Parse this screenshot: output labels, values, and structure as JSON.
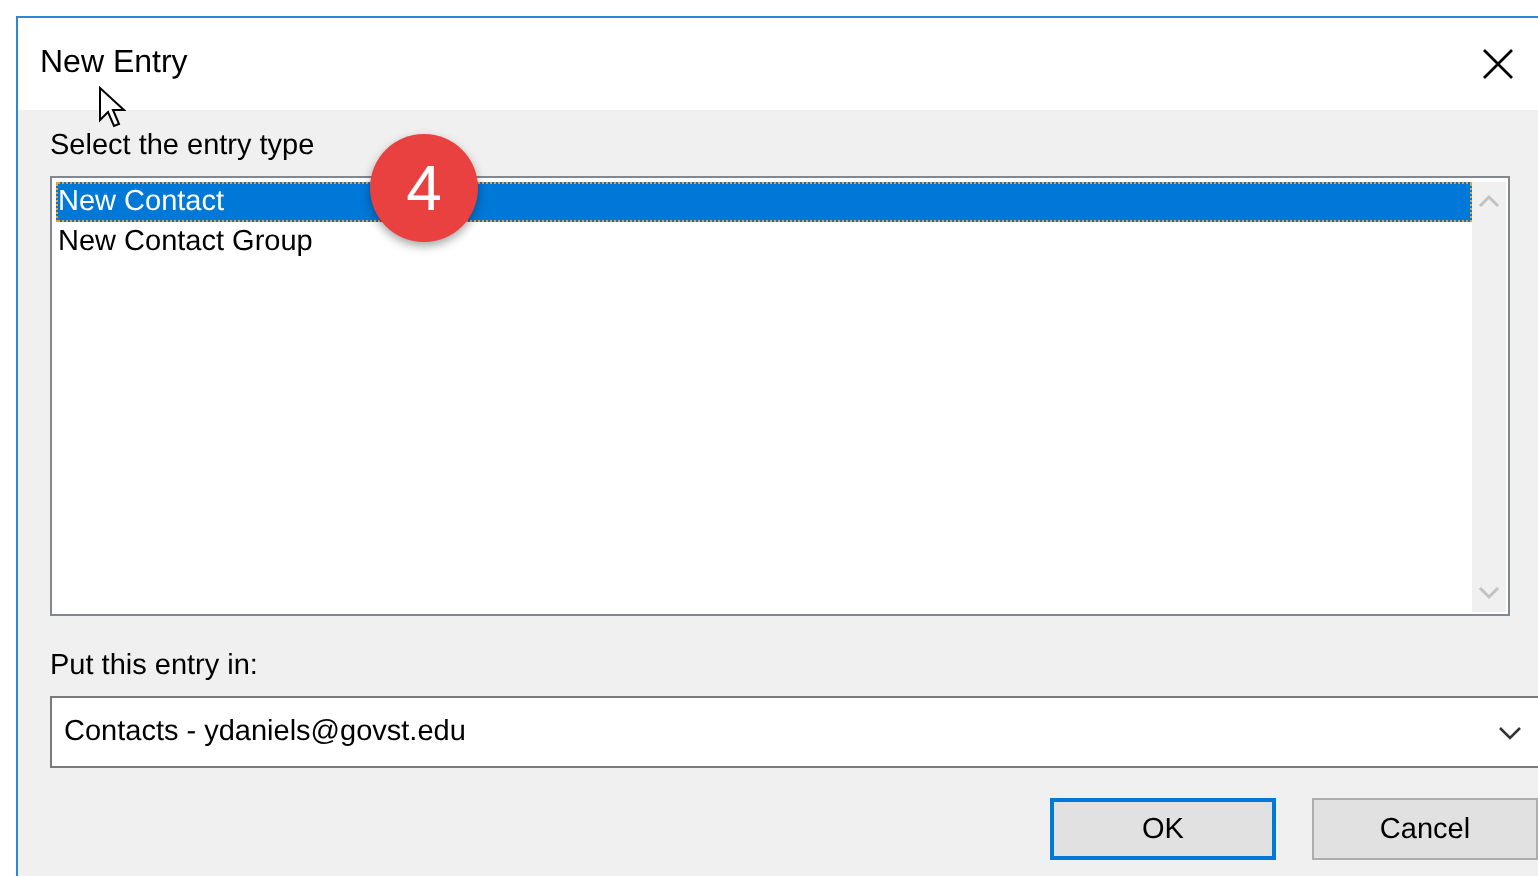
{
  "window": {
    "title": "New Entry"
  },
  "callout": {
    "number": "4"
  },
  "entry_type": {
    "label": "Select the entry type",
    "items": [
      {
        "label": "New Contact",
        "selected": true
      },
      {
        "label": "New Contact Group",
        "selected": false
      }
    ]
  },
  "location": {
    "label": "Put this entry in:",
    "value": "Contacts - ydaniels@govst.edu"
  },
  "buttons": [
    {
      "label": "OK",
      "default": true
    },
    {
      "label": "Cancel",
      "default": false
    }
  ]
}
